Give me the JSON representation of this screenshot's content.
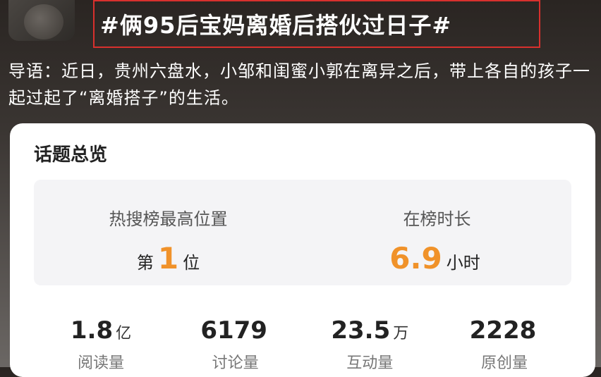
{
  "header": {
    "title": "#俩95后宝妈离婚后搭伙过日子#"
  },
  "intro": "导语：近日，贵州六盘水，小邹和闺蜜小郭在离异之后，带上各自的孩子一起过起了“离婚搭子”的生活。",
  "card": {
    "title": "话题总览",
    "rank": {
      "label": "热搜榜最高位置",
      "prefix": "第",
      "value": "1",
      "suffix": "位"
    },
    "duration": {
      "label": "在榜时长",
      "value": "6.9",
      "unit": "小时"
    },
    "metrics": [
      {
        "value": "1.8",
        "unit": "亿",
        "label": "阅读量"
      },
      {
        "value": "6179",
        "unit": "",
        "label": "讨论量"
      },
      {
        "value": "23.5",
        "unit": "万",
        "label": "互动量"
      },
      {
        "value": "2228",
        "unit": "",
        "label": "原创量"
      }
    ]
  },
  "colors": {
    "highlight_border": "#d8302d",
    "accent_number": "#f0922a"
  }
}
